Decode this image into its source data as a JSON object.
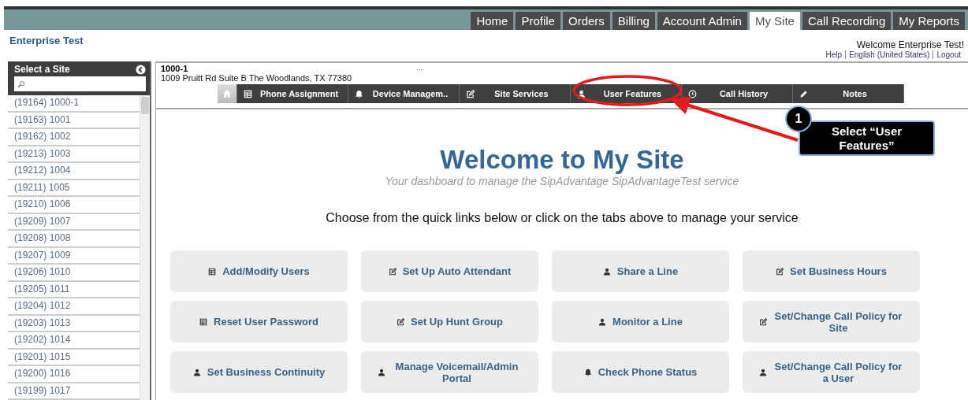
{
  "top_nav": [
    {
      "label": "Home",
      "selected": false
    },
    {
      "label": "Profile",
      "selected": false
    },
    {
      "label": "Orders",
      "selected": false
    },
    {
      "label": "Billing",
      "selected": false
    },
    {
      "label": "Account Admin",
      "selected": false
    },
    {
      "label": "My Site",
      "selected": true
    },
    {
      "label": "Call Recording",
      "selected": false
    },
    {
      "label": "My Reports",
      "selected": false
    }
  ],
  "enterprise_name": "Enterprise Test",
  "welcome": "Welcome Enterprise Test!",
  "header_links": [
    "Help",
    "English (United States)",
    "Logout"
  ],
  "sidebar": {
    "title": "Select a Site",
    "sites": [
      {
        "label": "(19164) 1000-1"
      },
      {
        "label": "(19163) 1001"
      },
      {
        "label": "(19162) 1002"
      },
      {
        "label": "(19213) 1003"
      },
      {
        "label": "(19212) 1004"
      },
      {
        "label": "(19211) 1005"
      },
      {
        "label": "(19210) 1006"
      },
      {
        "label": "(19209) 1007"
      },
      {
        "label": "(19208) 1008"
      },
      {
        "label": "(19207) 1009"
      },
      {
        "label": "(19206) 1010"
      },
      {
        "label": "(19205) 1011"
      },
      {
        "label": "(19204) 1012"
      },
      {
        "label": "(19203) 1013"
      },
      {
        "label": "(19202) 1014"
      },
      {
        "label": "(19201) 1015"
      },
      {
        "label": "(19200) 1016"
      },
      {
        "label": "(19199) 1017"
      }
    ]
  },
  "site": {
    "name": "1000-1",
    "address": "1009 Pruitt Rd Suite B The Woodlands, TX 77380",
    "marker": "...."
  },
  "sub_tabs": [
    {
      "kind": "home",
      "selected": true
    },
    {
      "label": "Phone Assignment",
      "kind": "table",
      "selected": false
    },
    {
      "label": "Device Managem..",
      "kind": "bell",
      "selected": false
    },
    {
      "label": "Site Services",
      "kind": "edit",
      "selected": false
    },
    {
      "label": "User Features",
      "kind": "person",
      "selected": false
    },
    {
      "label": "Call History",
      "kind": "clock",
      "selected": false
    },
    {
      "label": "Notes",
      "kind": "pencil",
      "selected": false
    }
  ],
  "dashboard": {
    "title": "Welcome to My Site",
    "subtitle": "Your dashboard to manage the SipAdvantage SipAdvantageTest service",
    "prompt": "Choose from the quick links below or click on the tabs above to manage your service"
  },
  "quick_links": [
    {
      "label": "Add/Modify Users",
      "kind": "table"
    },
    {
      "label": "Set Up Auto Attendant",
      "kind": "edit"
    },
    {
      "label": "Share a Line",
      "kind": "person"
    },
    {
      "label": "Set Business Hours",
      "kind": "edit"
    },
    {
      "label": "Reset User Password",
      "kind": "table"
    },
    {
      "label": "Set Up Hunt Group",
      "kind": "edit"
    },
    {
      "label": "Monitor a Line",
      "kind": "person"
    },
    {
      "label": "Set/Change Call Policy for Site",
      "kind": "edit"
    },
    {
      "label": "Set Business Continuity",
      "kind": "person"
    },
    {
      "label": "Manage Voicemail/Admin Portal",
      "kind": "person"
    },
    {
      "label": "Check Phone Status",
      "kind": "bell"
    },
    {
      "label": "Set/Change Call Policy for a User",
      "kind": "person"
    }
  ],
  "annotation": {
    "step": "1",
    "text": "Select “User Features”"
  }
}
